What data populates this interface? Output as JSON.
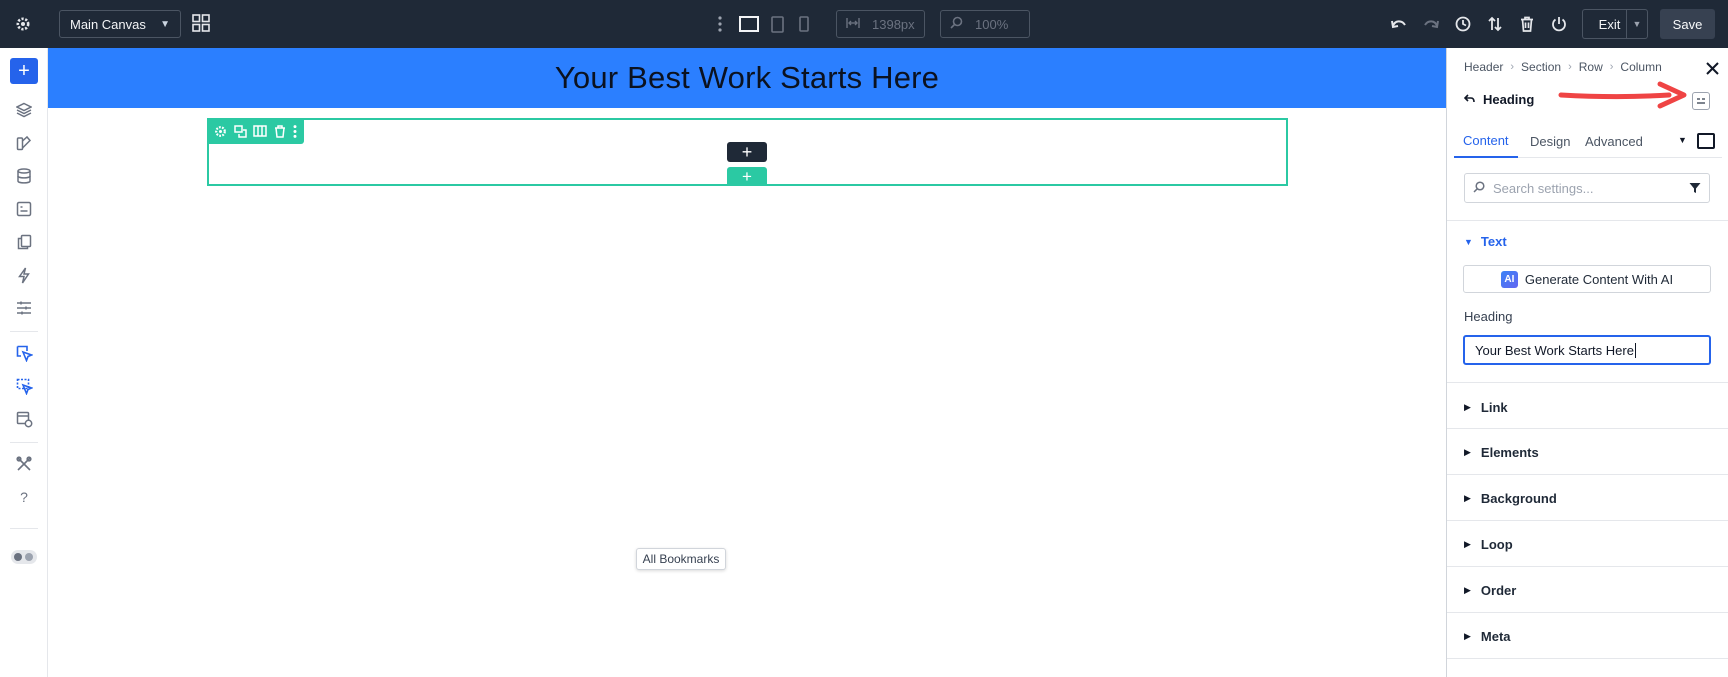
{
  "toolbar": {
    "canvas_select": "Main Canvas",
    "width_value": "1398px",
    "zoom_value": "100%",
    "exit_label": "Exit",
    "save_label": "Save"
  },
  "canvas": {
    "hero_heading": "Your Best Work Starts Here",
    "tooltip": "All Bookmarks"
  },
  "panel": {
    "breadcrumb": [
      "Header",
      "Section",
      "Row",
      "Column"
    ],
    "module_title": "Heading",
    "tabs": [
      "Content",
      "Design",
      "Advanced"
    ],
    "search_placeholder": "Search settings...",
    "open_section": "Text",
    "generate_label": "Generate Content With AI",
    "ai_badge": "AI",
    "heading_label": "Heading",
    "heading_value": "Your Best Work Starts Here",
    "sections": [
      "Link",
      "Elements",
      "Background",
      "Loop",
      "Order",
      "Meta"
    ]
  },
  "colors": {
    "topbar": "#1f2937",
    "hero_bg": "#2b7fff",
    "accent": "#2563eb",
    "row_outline": "#2bc9a3",
    "annotation_arrow": "#ef4444"
  }
}
